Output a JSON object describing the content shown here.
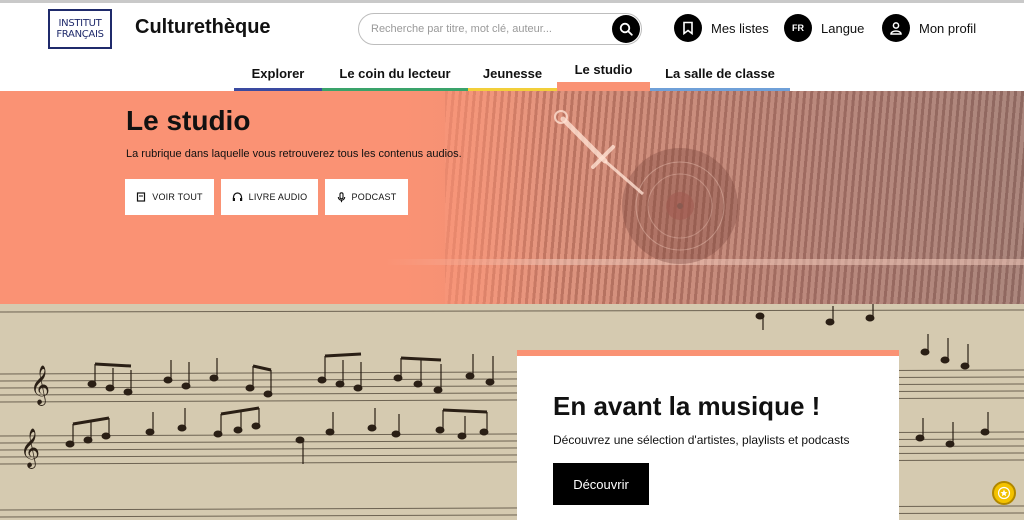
{
  "header": {
    "logo_line1": "INSTITUT",
    "logo_line2": "FRANÇAIS",
    "site_title": "Culturethèque",
    "search_placeholder": "Recherche par titre, mot clé, auteur...",
    "my_lists": "Mes listes",
    "language_code": "FR",
    "language": "Langue",
    "profile": "Mon profil"
  },
  "nav": {
    "tabs": [
      {
        "label": "Explorer",
        "color": "#3a4aa0"
      },
      {
        "label": "Le coin du lecteur",
        "color": "#3aa36b"
      },
      {
        "label": "Jeunesse",
        "color": "#f2cf3a"
      },
      {
        "label": "Le studio",
        "color": "#fa9274",
        "active": true
      },
      {
        "label": "La salle de classe",
        "color": "#6fa0d8"
      }
    ]
  },
  "hero": {
    "title": "Le studio",
    "subtitle": "La rubrique dans laquelle vous retrouverez tous les contenus audios.",
    "buttons": [
      {
        "label": "VOIR TOUT",
        "icon": "book-icon"
      },
      {
        "label": "LIVRE AUDIO",
        "icon": "headphones-icon"
      },
      {
        "label": "PODCAST",
        "icon": "microphone-icon"
      }
    ],
    "color": "#fa9274"
  },
  "feature": {
    "title": "En avant la musique !",
    "text": "Découvrez une sélection d'artistes, playlists et podcasts",
    "button": "Découvrir"
  }
}
